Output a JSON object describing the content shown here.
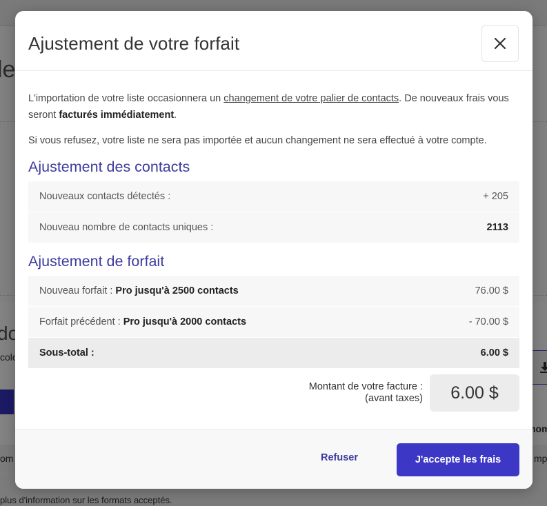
{
  "background": {
    "top_text": "",
    "left_fragment_1": "le",
    "left_fragment_2": "do",
    "left_fragment_3": "colo",
    "left_fragment_4": "om",
    "right_fragment_1": "nom",
    "right_fragment_2": "mp",
    "bottom_text": "plus d'information sur les formats acceptés."
  },
  "modal": {
    "title": "Ajustement de votre forfait",
    "close_icon": "close-icon",
    "intro": {
      "text_before_link": "L'importation de votre liste occasionnera un ",
      "link_text": "changement de votre palier de contacts",
      "text_after_link": ". De nouveaux frais vous seront ",
      "bold_text": "facturés immédiatement",
      "end": "."
    },
    "refusal_note": "Si vous refusez, votre liste ne sera pas importée et aucun changement ne sera effectué à votre compte.",
    "contacts_section": {
      "title": "Ajustement des contacts",
      "rows": [
        {
          "label": "Nouveaux contacts détectés :",
          "value": "+ 205"
        },
        {
          "label": "Nouveau nombre de contacts uniques :",
          "value": "2113"
        }
      ]
    },
    "plan_section": {
      "title": "Ajustement de forfait",
      "new_plan": {
        "label": "Nouveau forfait : ",
        "plan": "Pro jusqu'à 2500 contacts",
        "value": "76.00 $"
      },
      "previous_plan": {
        "label": "Forfait précédent : ",
        "plan": "Pro jusqu'à 2000 contacts",
        "value": "- 70.00 $"
      },
      "subtotal": {
        "label": "Sous-total :",
        "value": "6.00 $"
      }
    },
    "invoice": {
      "label_line1": "Montant de votre facture :",
      "label_line2": "(avant taxes)",
      "amount": "6.00 $"
    },
    "footer": {
      "refuse_label": "Refuser",
      "accept_label": "J'accepte les frais"
    }
  },
  "colors": {
    "accent": "#3c37c4",
    "section_title": "#3d3a9e"
  }
}
